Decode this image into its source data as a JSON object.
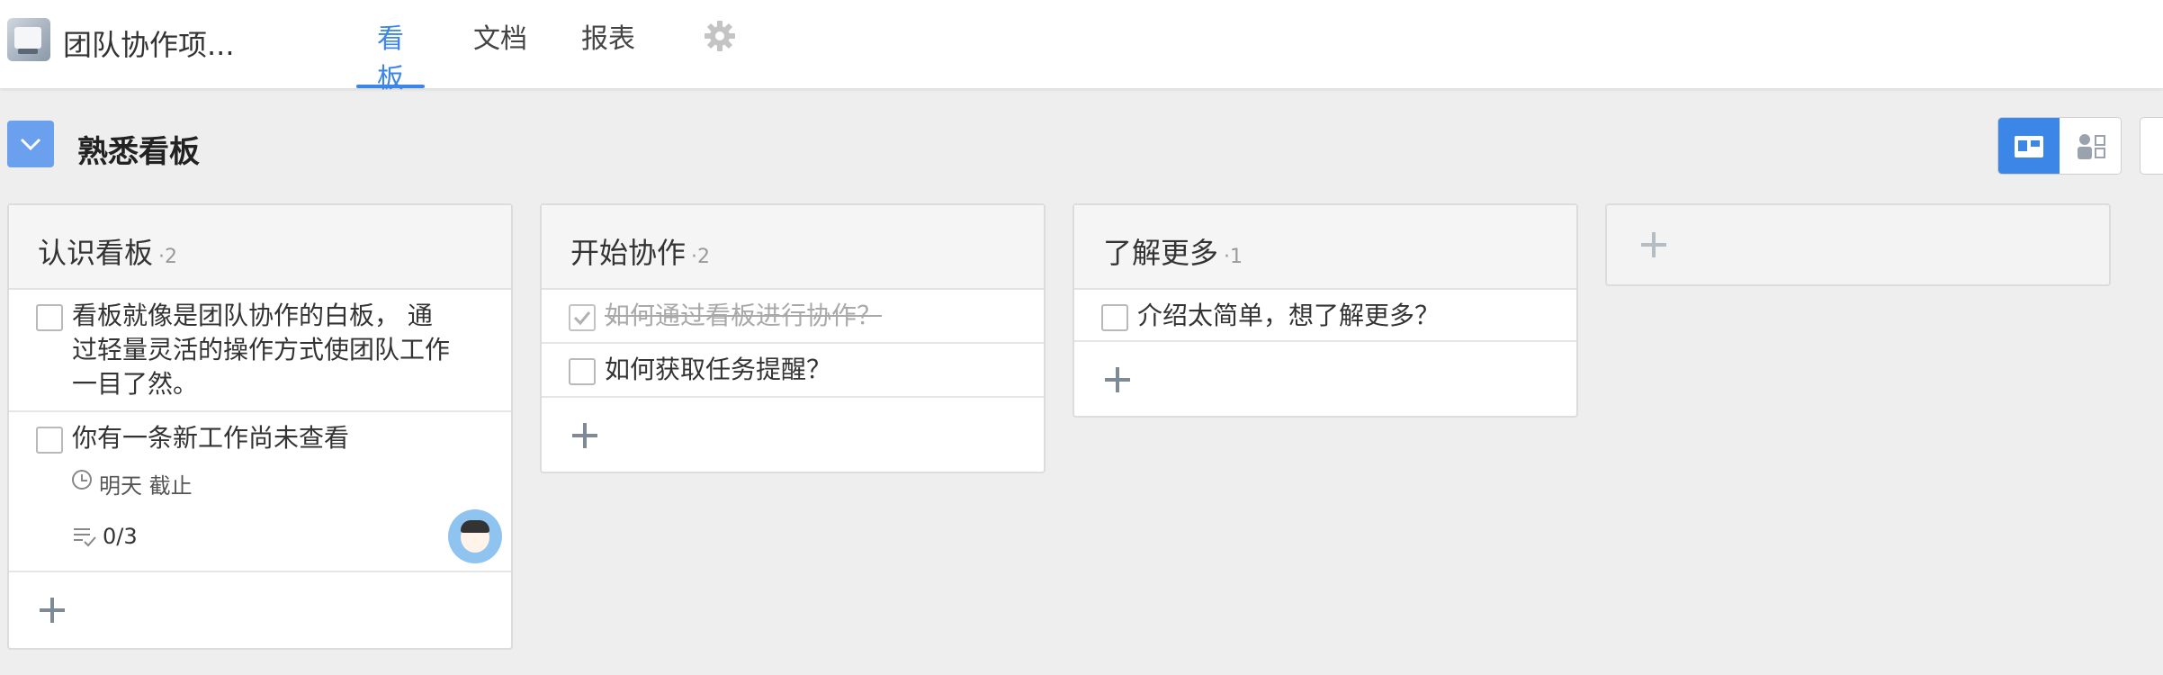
{
  "app": {
    "title": "团队协作项..."
  },
  "nav": {
    "tabs": [
      {
        "label": "看板",
        "active": true
      },
      {
        "label": "文档",
        "active": false
      },
      {
        "label": "报表",
        "active": false
      }
    ],
    "settings_icon": "gear-icon"
  },
  "board": {
    "title": "熟悉看板",
    "views": [
      "kanban-view-icon",
      "member-view-icon"
    ],
    "accent": "#3b86e6"
  },
  "lists": [
    {
      "name": "认识看板",
      "count": "·2",
      "cards": [
        {
          "text": "看板就像是团队协作的白板， 通过轻量灵活的操作方式使团队工作一目了然。",
          "done": false
        },
        {
          "text": "你有一条新工作尚未查看",
          "done": false,
          "due": "明天 截止",
          "checklist": "0/3"
        }
      ]
    },
    {
      "name": "开始协作",
      "count": "·2",
      "cards": [
        {
          "text": "如何通过看板进行协作？",
          "done": true
        },
        {
          "text": "如何获取任务提醒？",
          "done": false
        }
      ]
    },
    {
      "name": "了解更多",
      "count": "·1",
      "cards": [
        {
          "text": "介绍太简单，想了解更多？",
          "done": false
        }
      ]
    }
  ]
}
